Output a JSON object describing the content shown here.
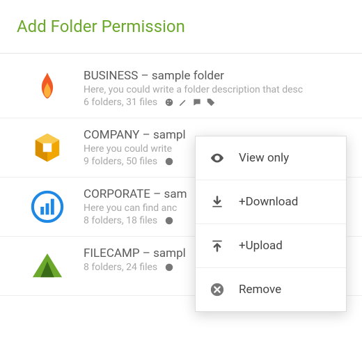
{
  "header": {
    "title": "Add Folder Permission"
  },
  "rows": [
    {
      "name": "BUSINESS – sample folder",
      "desc": "Here, you could write a folder description that desc",
      "meta": "6 folders, 31 files"
    },
    {
      "name": "COMPANY – sampl",
      "desc": "Here you could write",
      "meta": "9 folders, 50 files"
    },
    {
      "name": "CORPORATE – sam",
      "desc": "Here you can find anc",
      "meta": "8 folders, 18 files"
    },
    {
      "name": "FILECAMP – sampl",
      "desc": "",
      "meta": "8 folders, 24 files"
    }
  ],
  "menu": {
    "view": "View only",
    "download": "+Download",
    "upload": "+Upload",
    "remove": "Remove"
  }
}
